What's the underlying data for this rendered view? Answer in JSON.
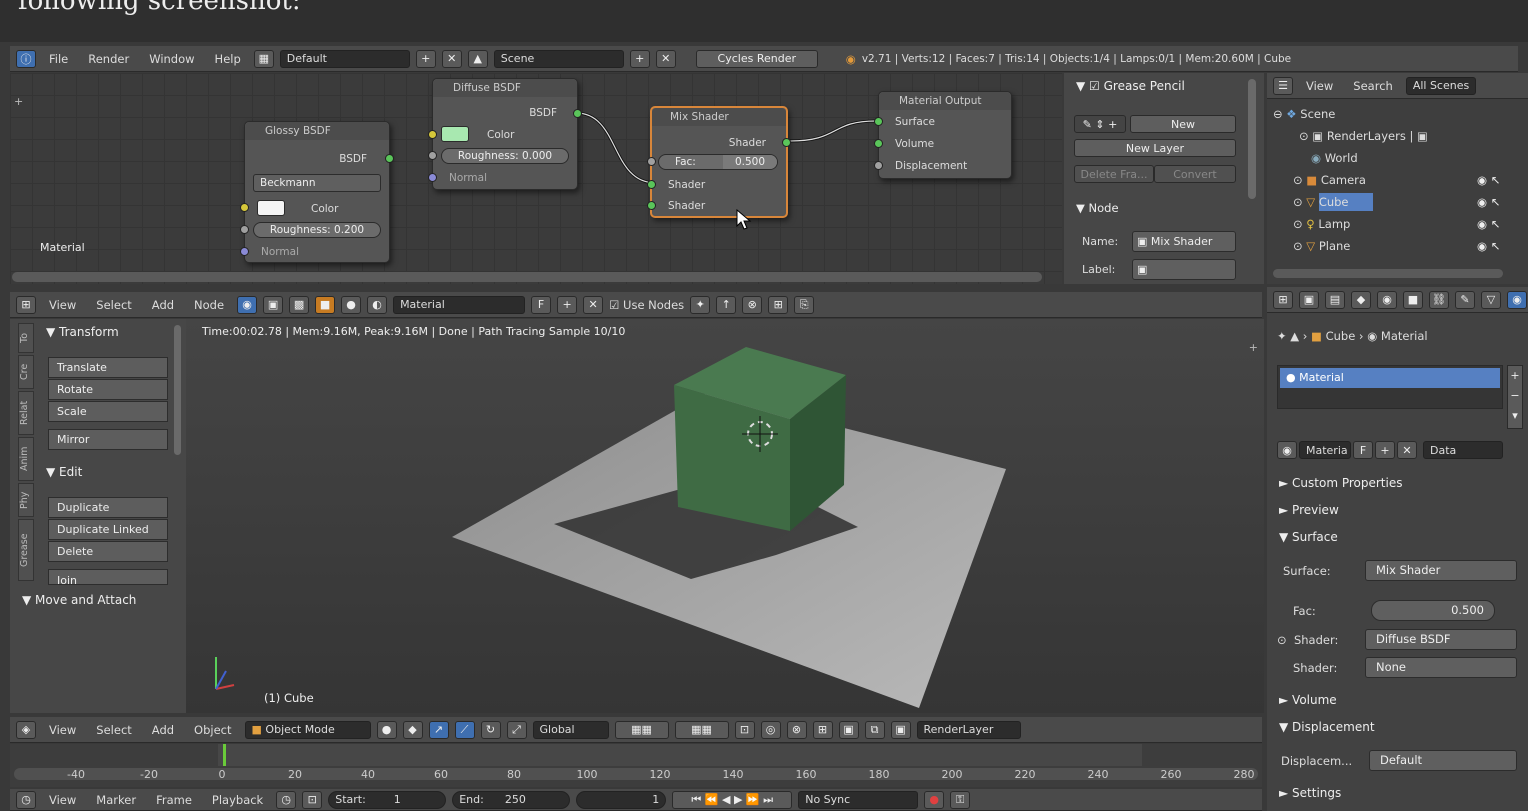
{
  "caption": "following screenshot:",
  "info_header": {
    "menus": [
      "File",
      "Render",
      "Window",
      "Help"
    ],
    "layout": "Default",
    "scene": "Scene",
    "engine": "Cycles Render",
    "stats": "v2.71 | Verts:12 | Faces:7 | Tris:14 | Objects:1/4 | Lamps:0/1 | Mem:20.60M | Cube"
  },
  "node_editor": {
    "context_label": "Material",
    "nodes": {
      "glossy": {
        "title": "Glossy BSDF",
        "out": "BSDF",
        "distribution": "Beckmann",
        "color": "Color",
        "roughness": "Roughness: 0.200",
        "normal": "Normal"
      },
      "diffuse": {
        "title": "Diffuse BSDF",
        "out": "BSDF",
        "color": "Color",
        "roughness": "Roughness: 0.000",
        "normal": "Normal"
      },
      "mix": {
        "title": "Mix Shader",
        "out": "Shader",
        "fac_label": "Fac:",
        "fac_value": "0.500",
        "in1": "Shader",
        "in2": "Shader"
      },
      "output": {
        "title": "Material Output",
        "surface": "Surface",
        "volume": "Volume",
        "displacement": "Displacement"
      }
    },
    "header": {
      "menus": [
        "View",
        "Select",
        "Add",
        "Node"
      ],
      "material": "Material",
      "f": "F",
      "use_nodes": "Use Nodes"
    }
  },
  "node_sidebar": {
    "grease_pencil": "Grease Pencil",
    "new": "New",
    "new_layer": "New Layer",
    "delete_frame": "Delete Fra...",
    "convert": "Convert",
    "node_section": "Node",
    "name_label": "Name:",
    "name_value": "Mix Shader",
    "label_label": "Label:"
  },
  "outliner": {
    "header": {
      "view": "View",
      "search": "Search",
      "scenes": "All Scenes"
    },
    "items": [
      "Scene",
      "RenderLayers",
      "World",
      "Camera",
      "Cube",
      "Lamp",
      "Plane"
    ]
  },
  "viewport": {
    "status": "Time:00:02.78 | Mem:9.16M, Peak:9.16M | Done | Path Tracing Sample 10/10",
    "object_label": "(1) Cube",
    "header": {
      "menus": [
        "View",
        "Select",
        "Add",
        "Object"
      ],
      "mode": "Object Mode",
      "orientation": "Global",
      "render_layer": "RenderLayer"
    }
  },
  "toolshelf": {
    "tabs": [
      "To",
      "Cre",
      "Relat",
      "Anim",
      "Phy",
      "Grease"
    ],
    "transform": "Transform",
    "transform_buttons": [
      "Translate",
      "Rotate",
      "Scale",
      "Mirror"
    ],
    "edit": "Edit",
    "edit_buttons": [
      "Duplicate",
      "Duplicate Linked",
      "Delete",
      "Join"
    ],
    "move_attach": "Move and Attach"
  },
  "properties": {
    "breadcrumb": [
      "Cube",
      "Material"
    ],
    "slot": "Material",
    "material_field": "Materia",
    "f": "F",
    "data": "Data",
    "panels": {
      "custom": "Custom Properties",
      "preview": "Preview",
      "surface": "Surface",
      "volume": "Volume",
      "displacement": "Displacement",
      "settings": "Settings"
    },
    "surface_label": "Surface:",
    "surface_value": "Mix Shader",
    "fac_label": "Fac:",
    "fac_value": "0.500",
    "shader1_label": "Shader:",
    "shader1_value": "Diffuse BSDF",
    "shader2_label": "Shader:",
    "shader2_value": "None",
    "displacement_label": "Displacem...",
    "displacement_value": "Default"
  },
  "timeline": {
    "ticks": [
      "-40",
      "-20",
      "0",
      "20",
      "40",
      "60",
      "80",
      "100",
      "120",
      "140",
      "160",
      "180",
      "200",
      "220",
      "240",
      "260",
      "280"
    ],
    "header": {
      "menus": [
        "View",
        "Marker",
        "Frame",
        "Playback"
      ],
      "start_label": "Start:",
      "start": "1",
      "end_label": "End:",
      "end": "250",
      "current": "1",
      "sync": "No Sync"
    }
  },
  "colors": {
    "accent": "#5680c2",
    "selected": "#d8863a",
    "material_green": "#3f6b44"
  }
}
